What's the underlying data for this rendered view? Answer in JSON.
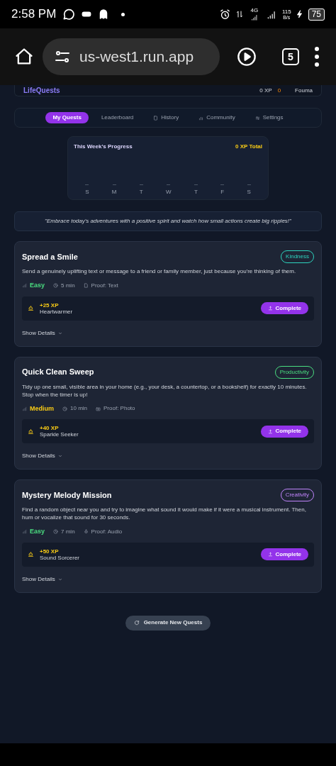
{
  "status_bar": {
    "time": "2:58 PM",
    "network": "4G",
    "speed": "115",
    "speed_unit": "B/s",
    "battery": "75"
  },
  "browser": {
    "url": "us-west1.run.app",
    "tab_count": "5"
  },
  "header": {
    "logo": "LifeQuests",
    "xp": "0 XP",
    "streak": "0",
    "user": "Fouma"
  },
  "tabs": [
    {
      "label": "My Quests",
      "selected": true
    },
    {
      "label": "Leaderboard",
      "selected": false
    },
    {
      "label": "History",
      "selected": false
    },
    {
      "label": "Community",
      "selected": false
    },
    {
      "label": "Settings",
      "selected": false
    }
  ],
  "progress": {
    "title": "This Week's Progress",
    "total": "0 XP Total",
    "days": [
      "S",
      "M",
      "T",
      "W",
      "T",
      "F",
      "S"
    ]
  },
  "quote": "\"Embrace today's adventures with a positive spirit and watch how small actions create big ripples!\"",
  "quests": [
    {
      "title": "Spread a Smile",
      "category": "Kindness",
      "color": "#2dd4bf",
      "description": "Send a genuinely uplifting text or message to a friend or family member, just because you're thinking of them.",
      "difficulty": {
        "label": "Easy",
        "color": "#4ade80"
      },
      "duration": "5 min",
      "proof": "Proof: Text",
      "xp": "+25 XP",
      "reward": "Heartwarmer",
      "button": "Complete",
      "details": "Show Details"
    },
    {
      "title": "Quick Clean Sweep",
      "category": "Productivity",
      "color": "#4ade80",
      "description": "Tidy up one small, visible area in your home (e.g., your desk, a countertop, or a bookshelf) for exactly 10 minutes. Stop when the timer is up!",
      "difficulty": {
        "label": "Medium",
        "color": "#facc15"
      },
      "duration": "10 min",
      "proof": "Proof: Photo",
      "xp": "+40 XP",
      "reward": "Sparkle Seeker",
      "button": "Complete",
      "details": "Show Details"
    },
    {
      "title": "Mystery Melody Mission",
      "category": "Creativity",
      "color": "#c084fc",
      "description": "Find a random object near you and try to imagine what sound it would make if it were a musical instrument. Then, hum or vocalize that sound for 30 seconds.",
      "difficulty": {
        "label": "Easy",
        "color": "#4ade80"
      },
      "duration": "7 min",
      "proof": "Proof: Audio",
      "xp": "+50 XP",
      "reward": "Sound Sorcerer",
      "button": "Complete",
      "details": "Show Details"
    }
  ],
  "generate_button": "Generate New Quests"
}
